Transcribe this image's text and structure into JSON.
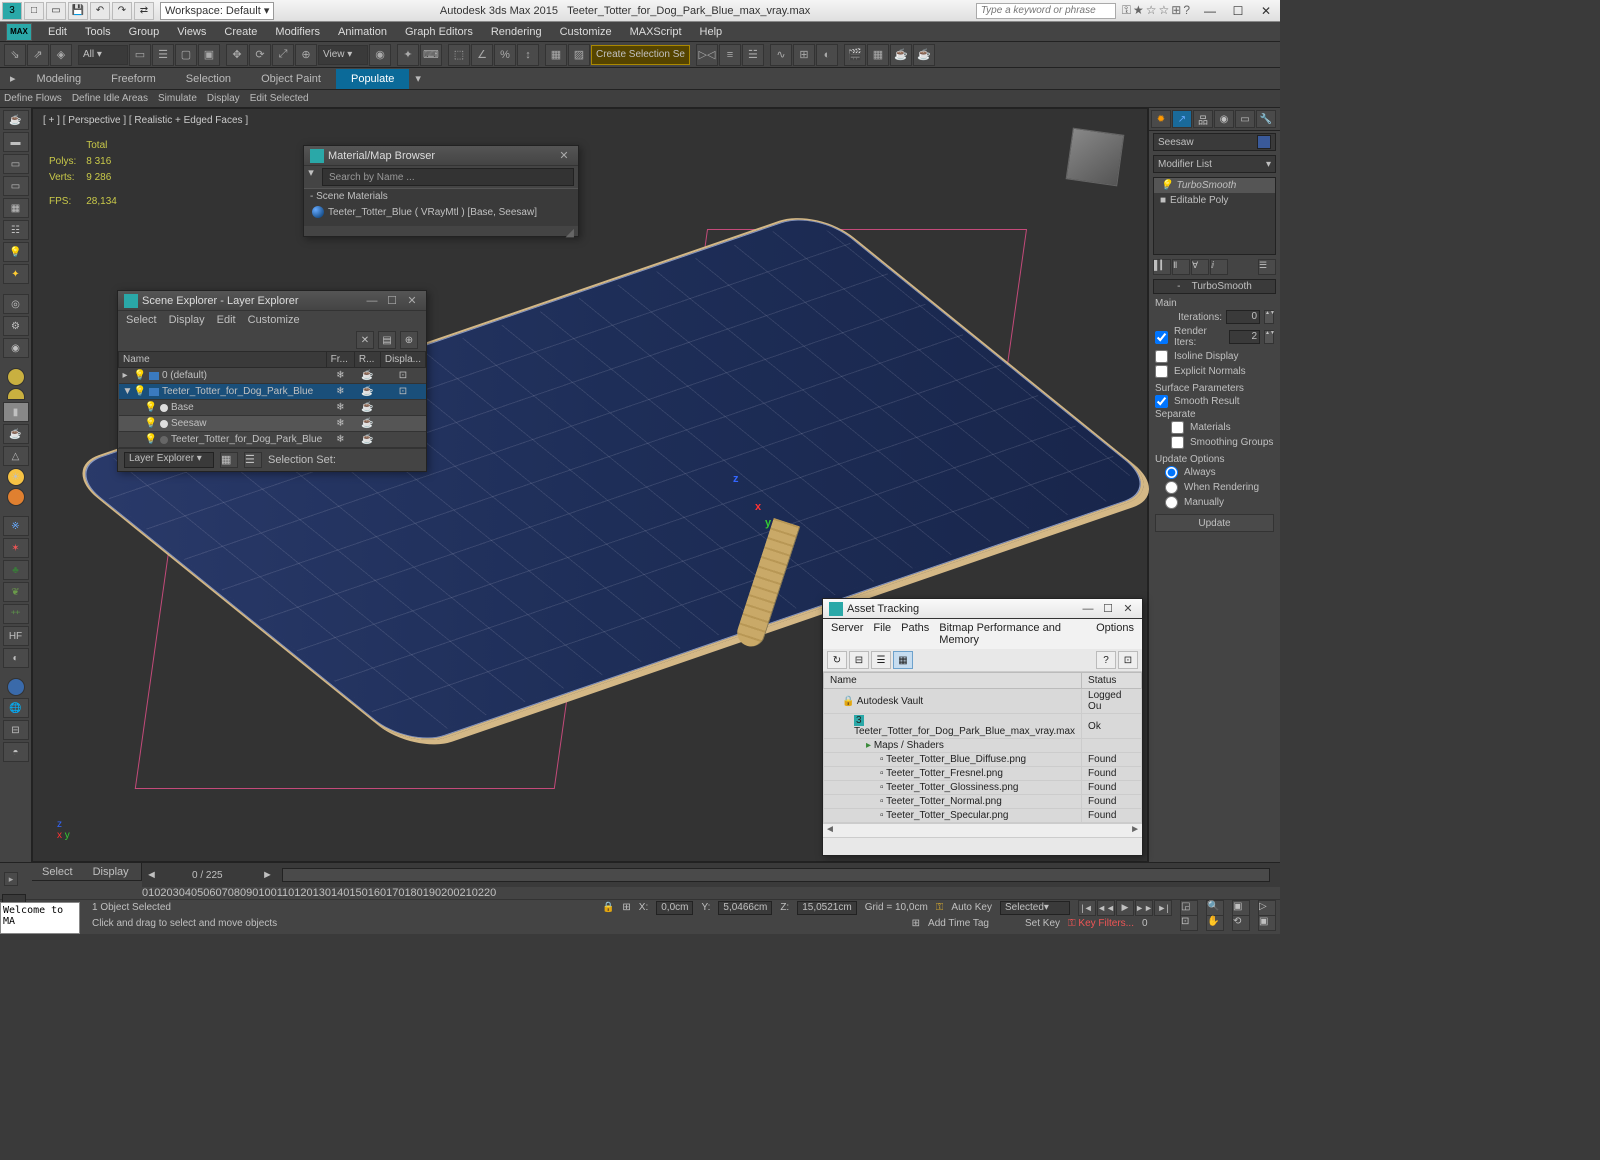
{
  "title": {
    "app": "Autodesk 3ds Max  2015",
    "file": "Teeter_Totter_for_Dog_Park_Blue_max_vray.max",
    "workspace": "Workspace: Default",
    "search_placeholder": "Type a keyword or phrase"
  },
  "menus": [
    "Edit",
    "Tools",
    "Group",
    "Views",
    "Create",
    "Modifiers",
    "Animation",
    "Graph Editors",
    "Rendering",
    "Customize",
    "MAXScript",
    "Help"
  ],
  "toolbar": {
    "layer_filter": "All",
    "view_dd": "View",
    "create_sel": "Create Selection Se"
  },
  "ribbon": {
    "tabs": [
      "Modeling",
      "Freeform",
      "Selection",
      "Object Paint",
      "Populate"
    ],
    "active": "Populate",
    "sub": [
      "Define Flows",
      "Define Idle Areas",
      "Simulate",
      "Display",
      "Edit Selected"
    ]
  },
  "viewport": {
    "label": "[ + ] [ Perspective ] [ Realistic + Edged Faces ]",
    "stats": {
      "polys_lbl": "Polys:",
      "polys": "8 316",
      "verts_lbl": "Verts:",
      "verts": "9 286",
      "fps_lbl": "FPS:",
      "fps": "28,134",
      "total_lbl": "Total"
    }
  },
  "mat_browser": {
    "title": "Material/Map Browser",
    "search": "Search by Name ...",
    "section": "- Scene Materials",
    "item": "Teeter_Totter_Blue ( VRayMtl )  [Base, Seesaw]"
  },
  "scene_explorer": {
    "title": "Scene Explorer - Layer Explorer",
    "menus": [
      "Select",
      "Display",
      "Edit",
      "Customize"
    ],
    "cols": [
      "Name",
      "Fr...",
      "R...",
      "Displa..."
    ],
    "rows": [
      {
        "name": "0 (default)",
        "indent": 0,
        "icon": "layer",
        "sel": false
      },
      {
        "name": "Teeter_Totter_for_Dog_Park_Blue",
        "indent": 0,
        "icon": "layer",
        "sel": true,
        "expand": "▼"
      },
      {
        "name": "Base",
        "indent": 1,
        "icon": "obj",
        "sel": false
      },
      {
        "name": "Seesaw",
        "indent": 1,
        "icon": "obj",
        "sel": "sel2"
      },
      {
        "name": "Teeter_Totter_for_Dog_Park_Blue",
        "indent": 1,
        "icon": "obj",
        "sel": false
      }
    ],
    "bottom_dd": "Layer Explorer",
    "sel_set": "Selection Set:"
  },
  "asset": {
    "title": "Asset Tracking",
    "menus": [
      "Server",
      "File",
      "Paths",
      "Bitmap Performance and Memory",
      "Options"
    ],
    "cols": [
      "Name",
      "Status"
    ],
    "rows": [
      {
        "name": "Autodesk Vault",
        "status": "Logged Ou",
        "indent": 0,
        "icon": "vault"
      },
      {
        "name": "Teeter_Totter_for_Dog_Park_Blue_max_vray.max",
        "status": "Ok",
        "indent": 1,
        "icon": "max"
      },
      {
        "name": "Maps / Shaders",
        "status": "",
        "indent": 2,
        "icon": "folder"
      },
      {
        "name": "Teeter_Totter_Blue_Diffuse.png",
        "status": "Found",
        "indent": 3,
        "icon": "img"
      },
      {
        "name": "Teeter_Totter_Fresnel.png",
        "status": "Found",
        "indent": 3,
        "icon": "img"
      },
      {
        "name": "Teeter_Totter_Glossiness.png",
        "status": "Found",
        "indent": 3,
        "icon": "img"
      },
      {
        "name": "Teeter_Totter_Normal.png",
        "status": "Found",
        "indent": 3,
        "icon": "img"
      },
      {
        "name": "Teeter_Totter_Specular.png",
        "status": "Found",
        "indent": 3,
        "icon": "img"
      }
    ]
  },
  "cmd_panel": {
    "obj_name": "Seesaw",
    "modlist": "Modifier List",
    "stack": [
      "TurboSmooth",
      "Editable Poly"
    ],
    "roll_title": "TurboSmooth",
    "main_lbl": "Main",
    "iter_lbl": "Iterations:",
    "iter_val": "0",
    "render_iter_lbl": "Render Iters:",
    "render_iter_val": "2",
    "iso": "Isoline Display",
    "expn": "Explicit Normals",
    "surf_lbl": "Surface Parameters",
    "smooth": "Smooth Result",
    "sep_lbl": "Separate",
    "mats": "Materials",
    "sg": "Smoothing Groups",
    "upd_lbl": "Update Options",
    "always": "Always",
    "render": "When Rendering",
    "manual": "Manually",
    "upd_btn": "Update"
  },
  "bottom": {
    "tabs": [
      "Select",
      "Display"
    ],
    "frame": "0 / 225",
    "ticks": [
      "0",
      "10",
      "20",
      "30",
      "40",
      "50",
      "60",
      "70",
      "80",
      "90",
      "100",
      "110",
      "120",
      "130",
      "140",
      "150",
      "160",
      "170",
      "180",
      "190",
      "200",
      "210",
      "220"
    ],
    "selcount": "1 Object Selected",
    "hint": "Click and drag to select and move objects",
    "coords": {
      "xlbl": "X:",
      "x": "0,0cm",
      "ylbl": "Y:",
      "y": "5,0466cm",
      "zlbl": "Z:",
      "z": "15,0521cm"
    },
    "grid": "Grid = 10,0cm",
    "autokey": "Auto Key",
    "selected_dd": "Selected",
    "setkey": "Set Key",
    "keyfilters": "Key Filters...",
    "addtime": "Add Time Tag",
    "maxscript": "Welcome to MA"
  }
}
